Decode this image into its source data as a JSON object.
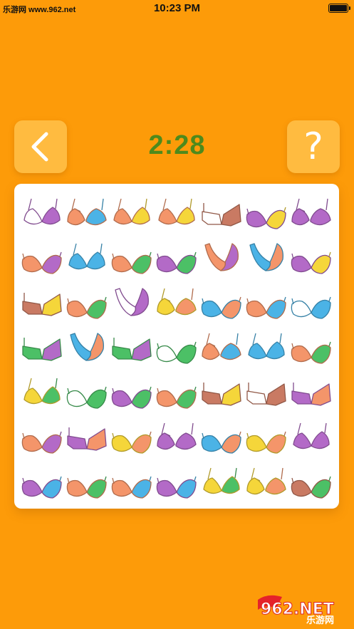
{
  "status_bar": {
    "watermark": "乐游网 www.962.net",
    "time": "10:23 PM"
  },
  "timer": "2:28",
  "buttons": {
    "back_icon": "chevron-left-icon",
    "help_label": "?"
  },
  "logo": {
    "text_main": "962.NET",
    "text_sub": "乐游网"
  },
  "palette": {
    "P": "#b36ac7",
    "O": "#f4956a",
    "B": "#4bb3e6",
    "G": "#4cc066",
    "Y": "#f5d63a",
    "R": "#c97a63",
    "W": "#ffffff"
  },
  "board": {
    "rows": [
      [
        {
          "v": "a",
          "l": "W",
          "r": "P"
        },
        {
          "v": "c",
          "l": "O",
          "r": "B"
        },
        {
          "v": "a",
          "l": "O",
          "r": "Y"
        },
        {
          "v": "a",
          "l": "O",
          "r": "Y"
        },
        {
          "v": "b",
          "l": "W",
          "r": "R"
        },
        {
          "v": "d",
          "l": "P",
          "r": "Y"
        },
        {
          "v": "c",
          "l": "P",
          "r": "P"
        }
      ],
      [
        {
          "v": "d",
          "l": "O",
          "r": "P"
        },
        {
          "v": "a",
          "l": "B",
          "r": "B"
        },
        {
          "v": "d",
          "l": "O",
          "r": "G"
        },
        {
          "v": "d",
          "l": "P",
          "r": "G"
        },
        {
          "v": "e",
          "l": "O",
          "r": "P"
        },
        {
          "v": "e",
          "l": "B",
          "r": "O"
        },
        {
          "v": "d",
          "l": "P",
          "r": "Y"
        }
      ],
      [
        {
          "v": "b",
          "l": "R",
          "r": "Y"
        },
        {
          "v": "d",
          "l": "O",
          "r": "G"
        },
        {
          "v": "e",
          "l": "W",
          "r": "P"
        },
        {
          "v": "c",
          "l": "Y",
          "r": "O"
        },
        {
          "v": "d",
          "l": "B",
          "r": "O"
        },
        {
          "v": "d",
          "l": "O",
          "r": "B"
        },
        {
          "v": "d",
          "l": "W",
          "r": "B"
        }
      ],
      [
        {
          "v": "b",
          "l": "G",
          "r": "P"
        },
        {
          "v": "e",
          "l": "B",
          "r": "O"
        },
        {
          "v": "b",
          "l": "G",
          "r": "P"
        },
        {
          "v": "d",
          "l": "W",
          "r": "G"
        },
        {
          "v": "c",
          "l": "O",
          "r": "B"
        },
        {
          "v": "a",
          "l": "B",
          "r": "B"
        },
        {
          "v": "d",
          "l": "O",
          "r": "G"
        }
      ],
      [
        {
          "v": "a",
          "l": "Y",
          "r": "G"
        },
        {
          "v": "d",
          "l": "W",
          "r": "G"
        },
        {
          "v": "d",
          "l": "P",
          "r": "G"
        },
        {
          "v": "d",
          "l": "O",
          "r": "G"
        },
        {
          "v": "b",
          "l": "R",
          "r": "Y"
        },
        {
          "v": "b",
          "l": "W",
          "r": "R"
        },
        {
          "v": "b",
          "l": "P",
          "r": "O"
        }
      ],
      [
        {
          "v": "d",
          "l": "O",
          "r": "P"
        },
        {
          "v": "b",
          "l": "P",
          "r": "O"
        },
        {
          "v": "d",
          "l": "Y",
          "r": "O"
        },
        {
          "v": "c",
          "l": "P",
          "r": "P"
        },
        {
          "v": "d",
          "l": "B",
          "r": "O"
        },
        {
          "v": "d",
          "l": "Y",
          "r": "O"
        },
        {
          "v": "a",
          "l": "P",
          "r": "P"
        }
      ],
      [
        {
          "v": "d",
          "l": "P",
          "r": "B"
        },
        {
          "v": "d",
          "l": "O",
          "r": "G"
        },
        {
          "v": "d",
          "l": "O",
          "r": "B"
        },
        {
          "v": "d",
          "l": "P",
          "r": "B"
        },
        {
          "v": "a",
          "l": "Y",
          "r": "G"
        },
        {
          "v": "c",
          "l": "Y",
          "r": "O"
        },
        {
          "v": "d",
          "l": "R",
          "r": "G"
        }
      ]
    ]
  }
}
